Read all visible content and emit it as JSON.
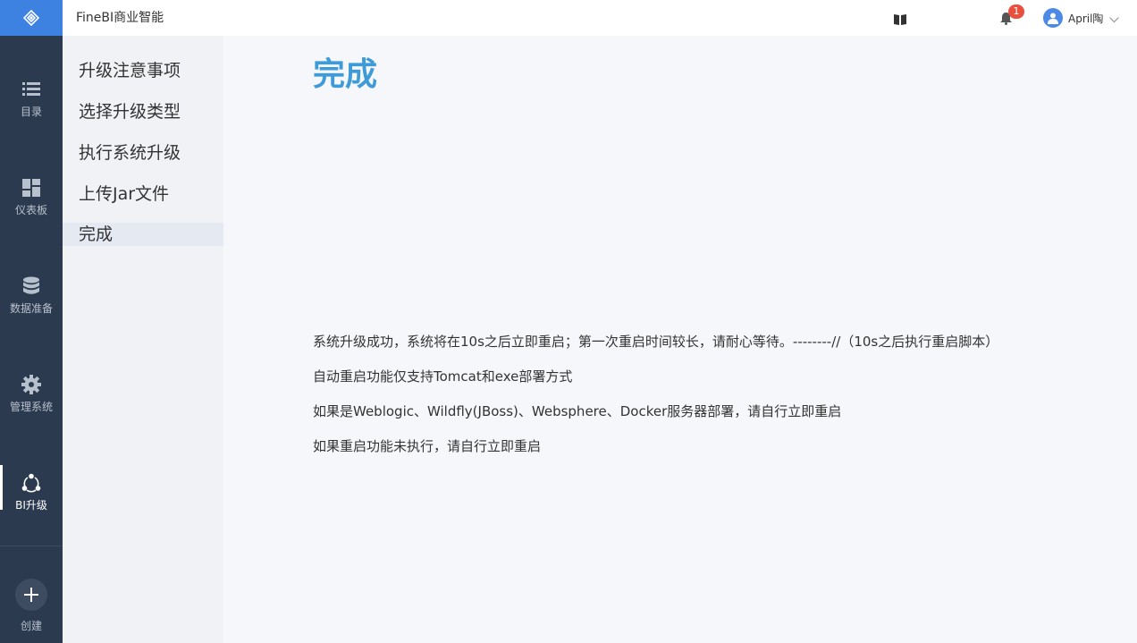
{
  "app": {
    "title": "FineBI商业智能"
  },
  "nav": {
    "items": [
      {
        "label": "目录",
        "icon": "list-icon"
      },
      {
        "label": "仪表板",
        "icon": "dashboard-icon"
      },
      {
        "label": "数据准备",
        "icon": "database-icon"
      },
      {
        "label": "管理系统",
        "icon": "gear-icon"
      },
      {
        "label": "BI升级",
        "icon": "upgrade-icon",
        "active": true
      }
    ],
    "create_label": "创建"
  },
  "header": {
    "notification_count": "1",
    "user_name": "April陶"
  },
  "steps": [
    {
      "label": "升级注意事项"
    },
    {
      "label": "选择升级类型"
    },
    {
      "label": "执行系统升级"
    },
    {
      "label": "上传Jar文件"
    },
    {
      "label": "完成",
      "active": true
    }
  ],
  "main": {
    "title": "完成",
    "messages": [
      "系统升级成功，系统将在10s之后立即重启；第一次重启时间较长，请耐心等待。--------//（10s之后执行重启脚本）",
      "自动重启功能仅支持Tomcat和exe部署方式",
      "如果是Weblogic、Wildfly(JBoss)、Websphere、Docker服务器部署，请自行立即重启",
      "如果重启功能未执行，请自行立即重启"
    ]
  },
  "colors": {
    "nav_bg": "#2c3a4f",
    "logo_bg": "#3d82e0",
    "title_blue": "#3f9bd8",
    "badge_red": "#e8503e"
  }
}
